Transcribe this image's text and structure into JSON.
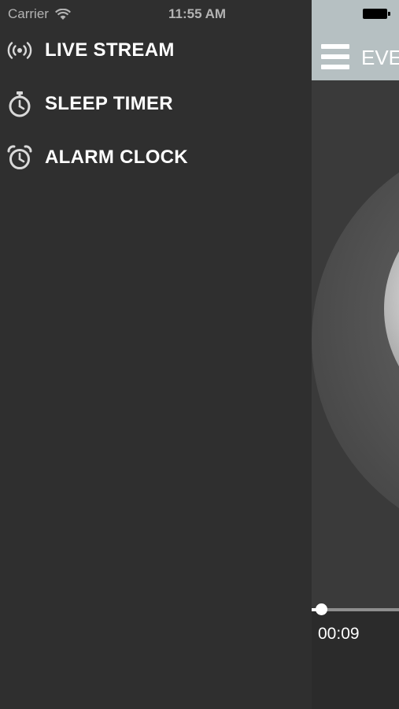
{
  "status_bar": {
    "carrier": "Carrier",
    "time": "11:55 AM"
  },
  "drawer": {
    "items": [
      {
        "label": "LIVE STREAM",
        "icon": "broadcast-icon"
      },
      {
        "label": "SLEEP TIMER",
        "icon": "stopwatch-icon"
      },
      {
        "label": "ALARM CLOCK",
        "icon": "alarm-clock-icon"
      }
    ]
  },
  "main": {
    "nav_title": "EVE",
    "navbar_color": "#b6c0c2",
    "player": {
      "elapsed": "00:09",
      "progress": 0.02
    }
  }
}
